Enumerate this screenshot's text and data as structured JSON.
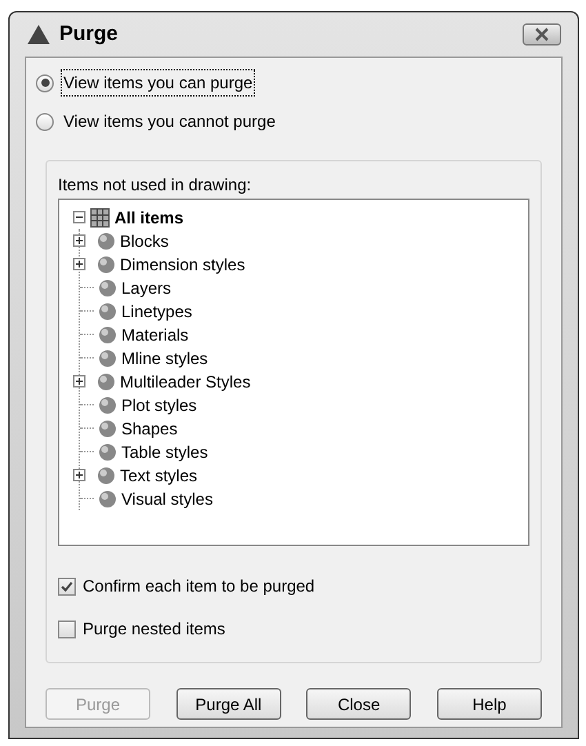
{
  "window": {
    "title": "Purge"
  },
  "view_options": [
    {
      "label": "View items you can purge",
      "selected": true
    },
    {
      "label": "View items you cannot purge",
      "selected": false
    }
  ],
  "group": {
    "label": "Items not used in drawing:",
    "tree": [
      {
        "label": "All items",
        "expanded": true,
        "children": [
          {
            "label": "Blocks",
            "expandable": true
          },
          {
            "label": "Dimension styles",
            "expandable": true
          },
          {
            "label": "Layers",
            "expandable": false
          },
          {
            "label": "Linetypes",
            "expandable": false
          },
          {
            "label": "Materials",
            "expandable": false
          },
          {
            "label": "Mline styles",
            "expandable": false
          },
          {
            "label": "Multileader Styles",
            "expandable": true
          },
          {
            "label": "Plot styles",
            "expandable": false
          },
          {
            "label": "Shapes",
            "expandable": false
          },
          {
            "label": "Table styles",
            "expandable": false
          },
          {
            "label": "Text styles",
            "expandable": true
          },
          {
            "label": "Visual styles",
            "expandable": false
          }
        ]
      }
    ],
    "options": [
      {
        "label": "Confirm each item to be purged",
        "checked": true
      },
      {
        "label": "Purge nested items",
        "checked": false
      }
    ]
  },
  "buttons": [
    {
      "label": "Purge",
      "disabled": true
    },
    {
      "label": "Purge All",
      "disabled": false
    },
    {
      "label": "Close",
      "disabled": false
    },
    {
      "label": "Help",
      "disabled": false
    }
  ]
}
